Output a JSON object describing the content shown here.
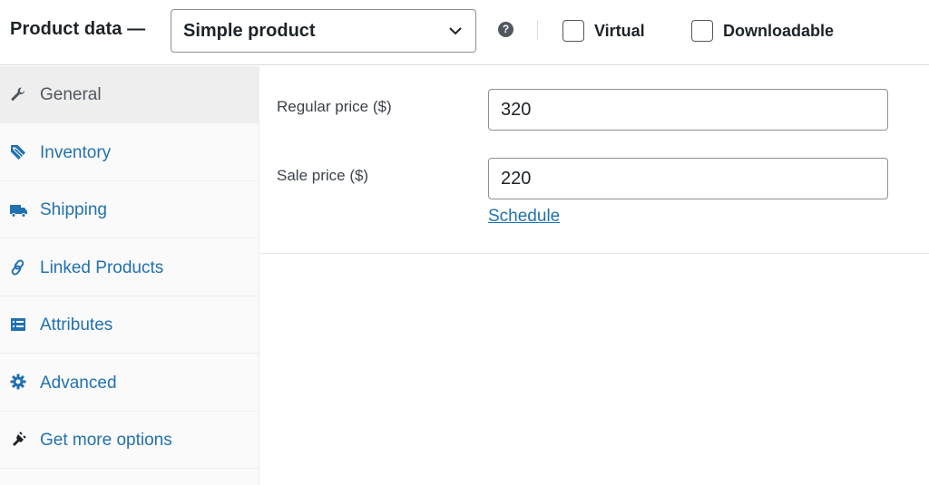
{
  "header": {
    "title": "Product data —",
    "product_type": "Simple product",
    "help_glyph": "?",
    "virtual_label": "Virtual",
    "virtual_checked": false,
    "downloadable_label": "Downloadable",
    "downloadable_checked": false
  },
  "sidebar": {
    "items": [
      {
        "label": "General",
        "icon": "wrench-icon",
        "active": true
      },
      {
        "label": "Inventory",
        "icon": "tag-icon",
        "active": false
      },
      {
        "label": "Shipping",
        "icon": "truck-icon",
        "active": false
      },
      {
        "label": "Linked Products",
        "icon": "link-icon",
        "active": false
      },
      {
        "label": "Attributes",
        "icon": "list-icon",
        "active": false
      },
      {
        "label": "Advanced",
        "icon": "gear-icon",
        "active": false
      },
      {
        "label": "Get more options",
        "icon": "plugin-icon",
        "active": false
      }
    ]
  },
  "general": {
    "regular_price_label": "Regular price ($)",
    "regular_price_value": "320",
    "sale_price_label": "Sale price ($)",
    "sale_price_value": "220",
    "schedule_link": "Schedule"
  },
  "colors": {
    "link": "#2271b1",
    "text": "#1d2327",
    "sidebar_bg": "#fafafa",
    "active_tab_bg": "#eeeeee",
    "border": "#8c8f94"
  }
}
